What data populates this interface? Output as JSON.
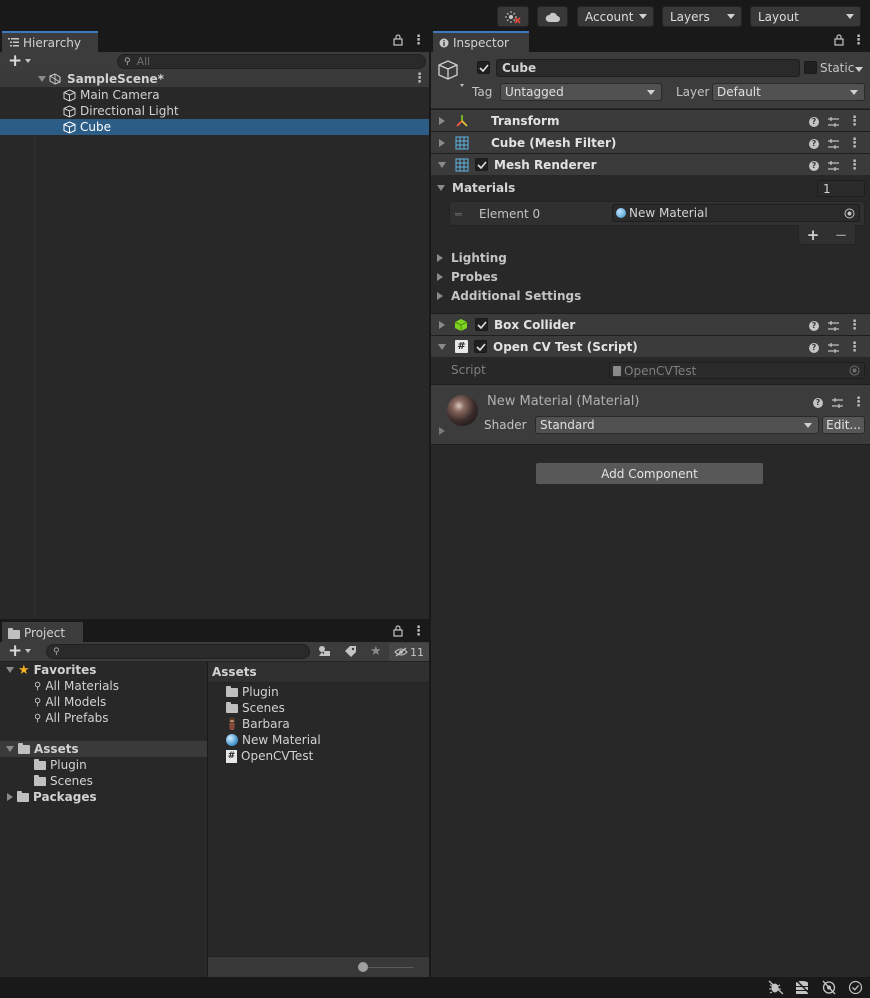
{
  "toolbar": {
    "account_label": "Account",
    "layers_label": "Layers",
    "layout_label": "Layout"
  },
  "hierarchy": {
    "tab_label": "Hierarchy",
    "search_placeholder": "All",
    "scene_name": "SampleScene*",
    "items": [
      {
        "label": "Main Camera",
        "icon": "gameobject-icon"
      },
      {
        "label": "Directional Light",
        "icon": "gameobject-icon"
      },
      {
        "label": "Cube",
        "icon": "gameobject-icon",
        "selected": true
      }
    ]
  },
  "inspector": {
    "tab_label": "Inspector",
    "object_name": "Cube",
    "static_label": "Static",
    "tag_label": "Tag",
    "tag_value": "Untagged",
    "layer_label": "Layer",
    "layer_value": "Default",
    "components": {
      "transform": "Transform",
      "mesh_filter": "Cube (Mesh Filter)",
      "mesh_renderer": "Mesh Renderer",
      "box_collider": "Box Collider",
      "script": "Open CV Test (Script)"
    },
    "materials": {
      "label": "Materials",
      "count": "1",
      "element_label": "Element 0",
      "element_value": "New Material"
    },
    "foldouts": [
      "Lighting",
      "Probes",
      "Additional Settings"
    ],
    "script_field": {
      "label": "Script",
      "value": "OpenCVTest"
    },
    "material_preview": {
      "title": "New Material (Material)",
      "shader_label": "Shader",
      "shader_value": "Standard",
      "edit_label": "Edit..."
    },
    "add_component_label": "Add Component"
  },
  "project": {
    "tab_label": "Project",
    "hidden_count": "11",
    "favorites_label": "Favorites",
    "favorites": [
      "All Materials",
      "All Models",
      "All Prefabs"
    ],
    "assets_label": "Assets",
    "asset_folders": [
      "Plugin",
      "Scenes"
    ],
    "packages_label": "Packages",
    "assets_header": "Assets",
    "assets_list": [
      {
        "label": "Plugin",
        "icon": "folder-icon"
      },
      {
        "label": "Scenes",
        "icon": "folder-icon"
      },
      {
        "label": "Barbara",
        "icon": "model-icon"
      },
      {
        "label": "New Material",
        "icon": "material-icon"
      },
      {
        "label": "OpenCVTest",
        "icon": "script-icon"
      }
    ]
  },
  "colors": {
    "selection": "#2c5d87",
    "tab_accent": "#3a79bb",
    "background": "#282828"
  }
}
